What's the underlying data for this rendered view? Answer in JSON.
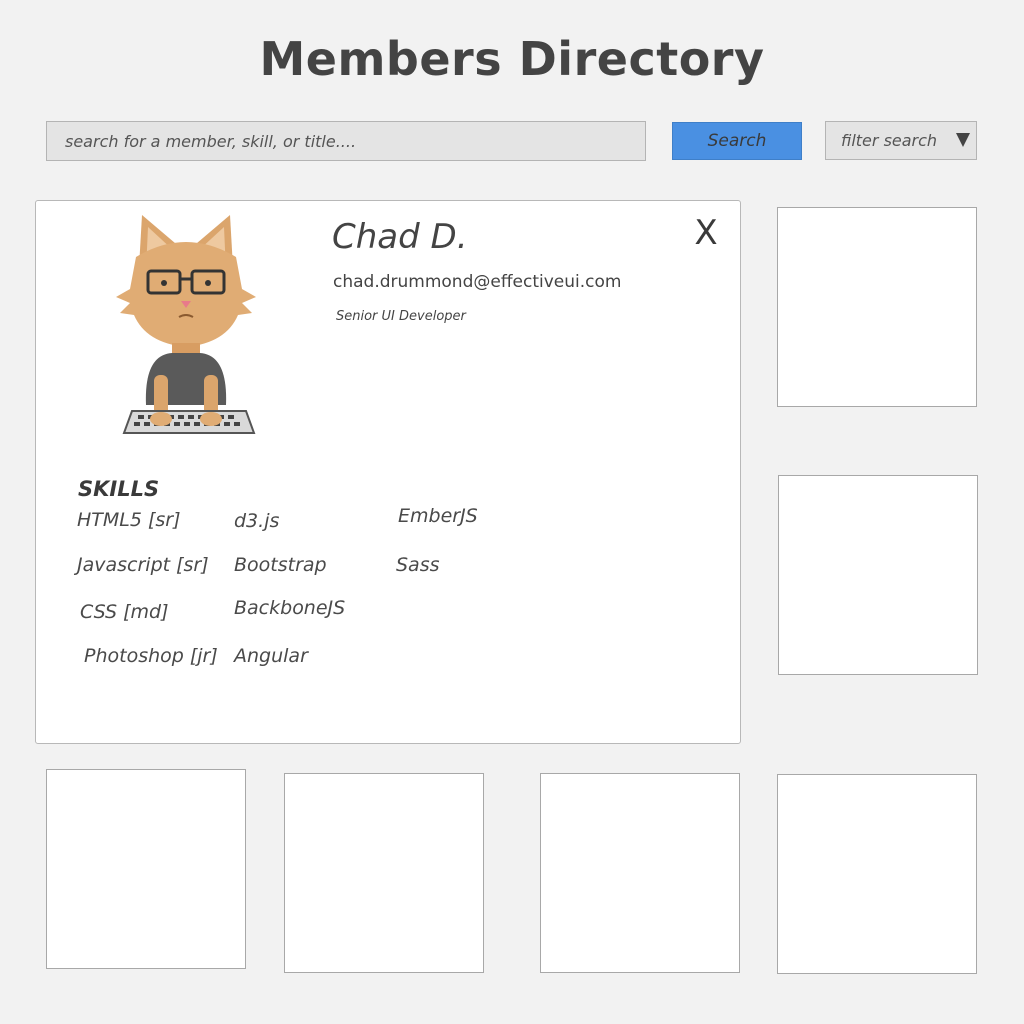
{
  "page": {
    "title": "Members Directory"
  },
  "search": {
    "placeholder": "search for a member, skill, or title....",
    "button_label": "Search",
    "filter_label": "filter search"
  },
  "profile": {
    "name": "Chad D.",
    "email": "chad.drummond@effectiveui.com",
    "title": "Senior UI Developer",
    "close_label": "X",
    "skills_heading": "SKILLS",
    "skills": [
      "HTML5  [sr]",
      "Javascript  [sr]",
      "CSS  [md]",
      "Photoshop [jr]",
      "d3.js",
      "Bootstrap",
      "BackboneJS",
      "Angular",
      "EmberJS",
      "Sass"
    ]
  },
  "colors": {
    "accent": "#4a90e2",
    "background": "#f2f2f2",
    "text": "#444444"
  },
  "icons": {
    "avatar": "cat-developer-avatar-icon",
    "filter_dropdown": "caret-down-icon",
    "close": "close-icon"
  }
}
